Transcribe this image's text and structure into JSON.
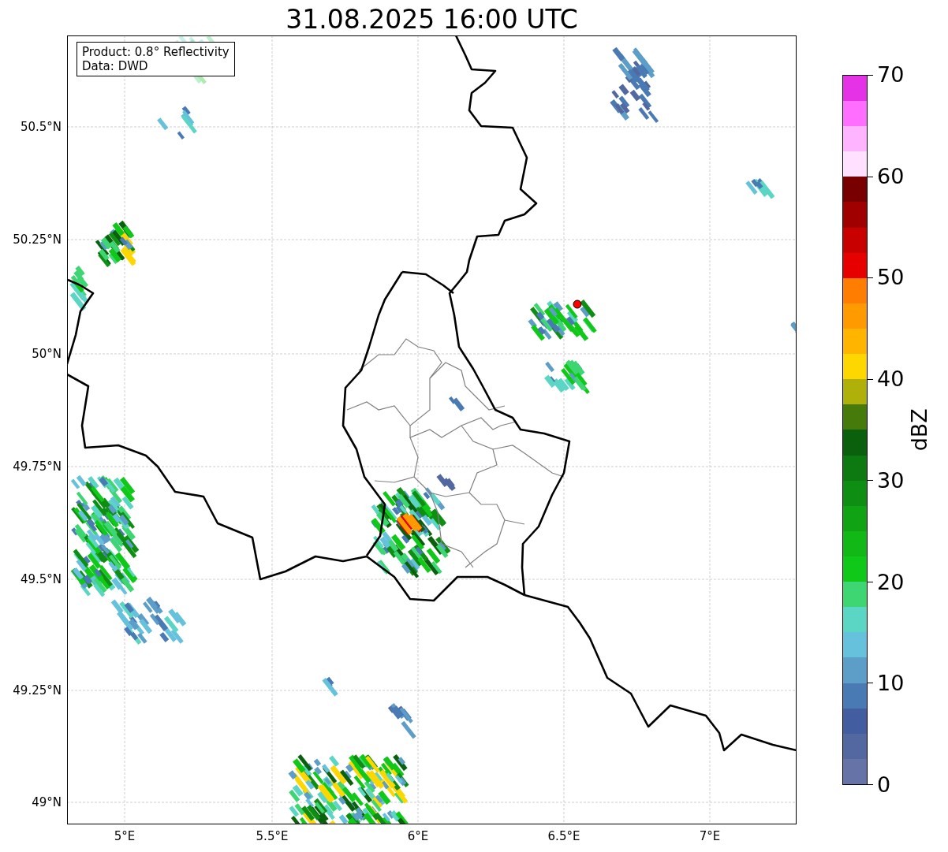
{
  "title": "31.08.2025 16:00 UTC",
  "info_box": {
    "lines": [
      "Product: 0.8° Reflectivity",
      "Data: DWD"
    ]
  },
  "map": {
    "y_ticks": [
      "50.5°N",
      "50.25°N",
      "50°N",
      "49.75°N",
      "49.5°N",
      "49.25°N",
      "49°N"
    ],
    "x_ticks": [
      "5°E",
      "5.5°E",
      "6°E",
      "6.5°E",
      "7°E"
    ]
  },
  "colorbar": {
    "label": "dBZ",
    "ticks": [
      "70",
      "60",
      "50",
      "40",
      "30",
      "20",
      "10",
      "0"
    ],
    "bins": [
      {
        "color": "#6673a6"
      },
      {
        "color": "#5368a0"
      },
      {
        "color": "#425ea0"
      },
      {
        "color": "#4a7ab4"
      },
      {
        "color": "#5c9ec8"
      },
      {
        "color": "#66c2dc"
      },
      {
        "color": "#5cd6c4"
      },
      {
        "color": "#3dd672"
      },
      {
        "color": "#10c818"
      },
      {
        "color": "#12b816"
      },
      {
        "color": "#10a414"
      },
      {
        "color": "#0e8e12"
      },
      {
        "color": "#0c7a10"
      },
      {
        "color": "#0a600c"
      },
      {
        "color": "#467a0a"
      },
      {
        "color": "#b0b00a"
      },
      {
        "color": "#ffd700"
      },
      {
        "color": "#ffb400"
      },
      {
        "color": "#ff9a00"
      },
      {
        "color": "#ff7d00"
      },
      {
        "color": "#e60000"
      },
      {
        "color": "#c80000"
      },
      {
        "color": "#a00000"
      },
      {
        "color": "#780000"
      },
      {
        "color": "#ffe0ff"
      },
      {
        "color": "#ffb4ff"
      },
      {
        "color": "#ff6eff"
      },
      {
        "color": "#e632e6"
      }
    ]
  }
}
